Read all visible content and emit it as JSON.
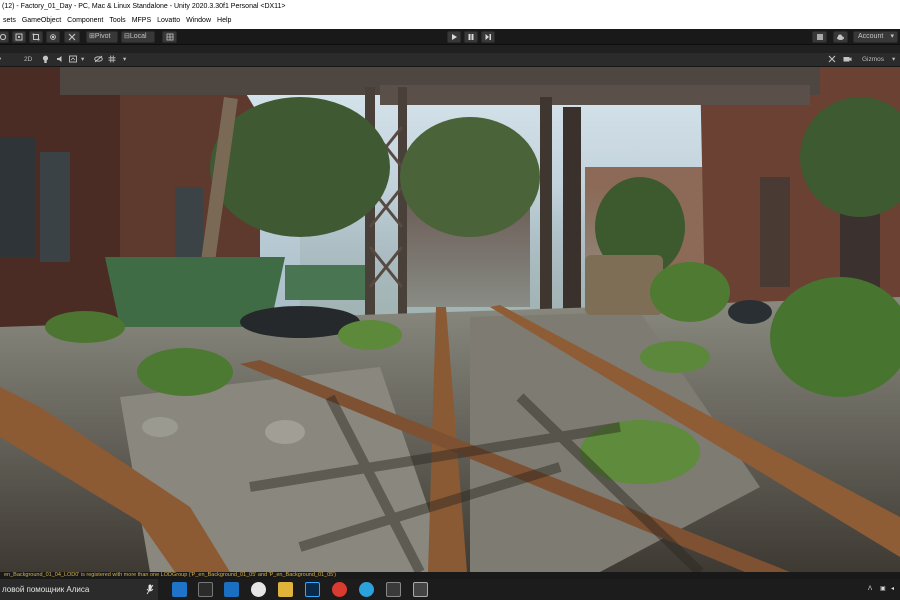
{
  "window": {
    "title": "(12) - Factory_01_Day - PC, Mac & Linux Standalone - Unity 2020.3.30f1 Personal <DX11>"
  },
  "menu": [
    "sets",
    "GameObject",
    "Component",
    "Tools",
    "MFPS",
    "Lovatto",
    "Window",
    "Help"
  ],
  "toolbar": {
    "pivot_label": "Pivot",
    "local_label": "Local",
    "account_label": "Account"
  },
  "scene_toolbar": {
    "mode_2d": "2D",
    "gizmos_label": "Gizmos"
  },
  "console": {
    "message": "en_Background_01_04_LOD0' is registered with more than one LODGroup ('P_en_Background_01_05' and 'P_en_Background_01_05')"
  },
  "taskbar": {
    "search_text": "ловой помощник Алиса",
    "apps": [
      "edge-icon",
      "store-icon",
      "mail-icon",
      "yandex-icon",
      "explorer-icon",
      "photoshop-icon",
      "yandex-browser-icon",
      "telegram-icon",
      "unity-hub-icon",
      "unity-icon"
    ]
  },
  "colors": {
    "editor_bg": "#191919",
    "toolbar_button": "#383838",
    "console_warning": "#d6b24a",
    "taskbar_bg": "#1c1c1c"
  }
}
